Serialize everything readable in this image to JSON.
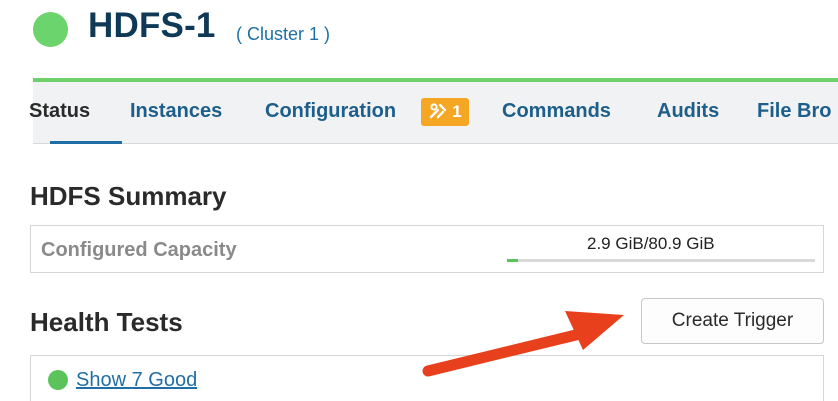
{
  "service": {
    "name": "HDFS-1",
    "cluster": "( Cluster 1 )",
    "status_color": "#6bd46c"
  },
  "tabs": [
    {
      "label": "Status",
      "active": true
    },
    {
      "label": "Instances",
      "active": false
    },
    {
      "label": "Configuration",
      "active": false,
      "badge": "1",
      "badge_icon": "tools-icon"
    },
    {
      "label": "Commands",
      "active": false
    },
    {
      "label": "Audits",
      "active": false
    },
    {
      "label": "File Bro",
      "active": false
    }
  ],
  "summary": {
    "title": "HDFS Summary",
    "capacity_label": "Configured Capacity",
    "capacity_value": "2.9 GiB/80.9 GiB",
    "capacity_fraction": 0.036
  },
  "health": {
    "title": "Health Tests",
    "create_trigger_label": "Create Trigger",
    "good_link": "Show 7 Good"
  },
  "colors": {
    "accent": "#1f6fa6",
    "good": "#5cc35c",
    "badge": "#f5a623",
    "annotation_arrow": "#e8401c"
  }
}
